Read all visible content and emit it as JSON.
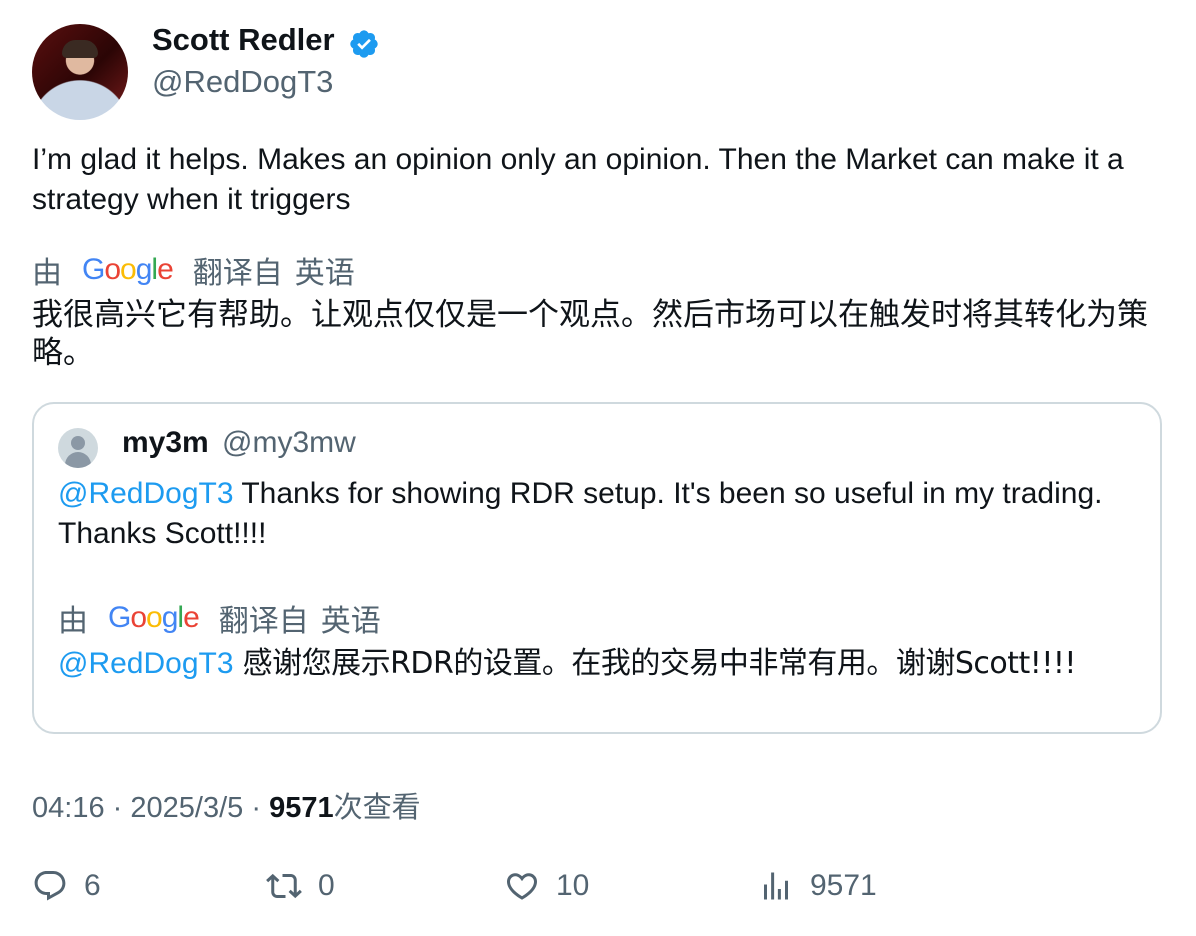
{
  "author": {
    "name": "Scott Redler",
    "handle": "@RedDogT3"
  },
  "tweet": {
    "text": "I’m glad it helps. Makes an opinion only an opinion.  Then the Market can make it a strategy when it triggers",
    "translation_by": "由",
    "translation_from": "翻译自",
    "translation_lang": "英语",
    "translated_text": "我很高兴它有帮助。让观点仅仅是一个观点。然后市场可以在触发时将其转化为策略。"
  },
  "google_logo": {
    "letters": [
      "G",
      "o",
      "o",
      "g",
      "l",
      "e"
    ]
  },
  "quote": {
    "name": "my3m",
    "handle": "@my3mw",
    "mention": "@RedDogT3",
    "text": " Thanks for showing RDR setup. It's been so useful in my trading. Thanks Scott!!!!",
    "translation_by": "由",
    "translation_from": "翻译自",
    "translation_lang": "英语",
    "translated_mention": "@RedDogT3",
    "translated_text": " 感谢您展示RDR的设置。在我的交易中非常有用。谢谢Scott!!!!"
  },
  "meta": {
    "time": "04:16",
    "separator": "·",
    "date": "2025/3/5",
    "views_count": "9571",
    "views_label": "次查看"
  },
  "actions": {
    "replies": "6",
    "retweets": "0",
    "likes": "10",
    "views": "9571"
  },
  "colors": {
    "accent": "#1d9bf0",
    "secondary_text": "#536471",
    "border": "#cfd9de"
  }
}
